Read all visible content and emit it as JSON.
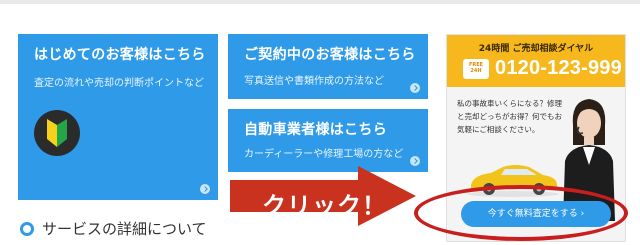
{
  "cards": {
    "first_time": {
      "title": "はじめてのお客様はこちら",
      "subtitle": "査定の流れや売却の判断ポイントなど"
    },
    "contracting": {
      "title": "ご契約中のお客様はこちら",
      "subtitle": "写真送信や書類作成の方法など"
    },
    "dealers": {
      "title": "自動車業者様はこちら",
      "subtitle": "カーディーラーや修理工場の方など"
    }
  },
  "phone_panel": {
    "header": "24時間 ご売却相談ダイヤル",
    "free_badge_top": "FREE",
    "free_badge_bottom": "24H",
    "number": "0120-123-999",
    "text": "私の事故車いくらになる？修理と売却どっちがお得？何でもお気軽にご相談ください。",
    "cta_label": "今すぐ無料査定をする ›"
  },
  "annotation": {
    "click_label": "クリック！"
  },
  "section": {
    "heading": "サービスの詳細について"
  },
  "colors": {
    "card_blue": "#2f9ae8",
    "header_yellow": "#f6b81c",
    "arrow_red": "#c8321e",
    "highlight_red": "#c81e1e"
  },
  "icons": {
    "beginner_mark": "wakaba-beginner-icon",
    "card_arrow": "chevron-right-icon",
    "bullet": "circle-bullet-icon"
  }
}
